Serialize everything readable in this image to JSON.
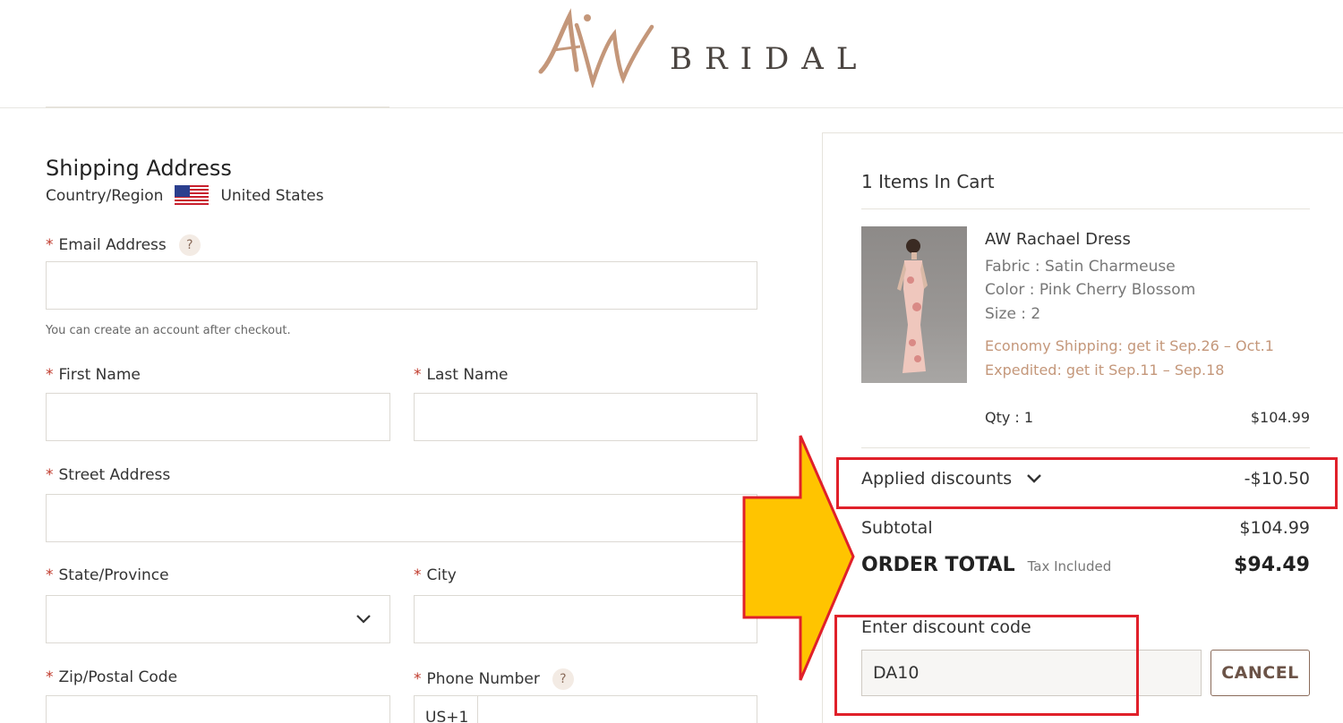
{
  "header": {
    "logo_text": "BRIDAL",
    "logo_mark_text": "AW"
  },
  "shipping": {
    "title": "Shipping Address",
    "country_label": "Country/Region",
    "country_value": "United States",
    "flag_icon": "us-flag-icon",
    "required_marker": "*",
    "help_marker": "?",
    "email_label": "Email Address",
    "email_value": "",
    "account_hint": "You can create an account after checkout.",
    "first_name_label": "First Name",
    "last_name_label": "Last Name",
    "street_label": "Street Address",
    "state_label": "State/Province",
    "city_label": "City",
    "zip_label": "Zip/Postal Code",
    "phone_label": "Phone Number",
    "phone_prefix": "US+1"
  },
  "cart": {
    "title": "1 Items In Cart",
    "product": {
      "name": "AW Rachael Dress",
      "fabric": "Fabric : Satin Charmeuse",
      "color": "Color : Pink Cherry Blossom",
      "size": "Size : 2",
      "economy_shipping": "Economy Shipping: get it Sep.26 – Oct.1",
      "expedited_shipping": "Expedited: get it Sep.11 – Sep.18",
      "qty": "Qty : 1",
      "price": "$104.99"
    },
    "discounts_label": "Applied discounts",
    "discounts_amount": "-$10.50",
    "subtotal_label": "Subtotal",
    "subtotal_amount": "$104.99",
    "total_label": "ORDER TOTAL",
    "tax_note": "Tax Included",
    "total_amount": "$94.49",
    "code_label": "Enter discount code",
    "code_value": "DA10",
    "cancel_label": "CANCEL"
  },
  "colors": {
    "accent": "#c4977a",
    "button_border": "#8a6b5a",
    "annotation_red": "#e0202a",
    "annotation_arrow": "#ffc400"
  }
}
